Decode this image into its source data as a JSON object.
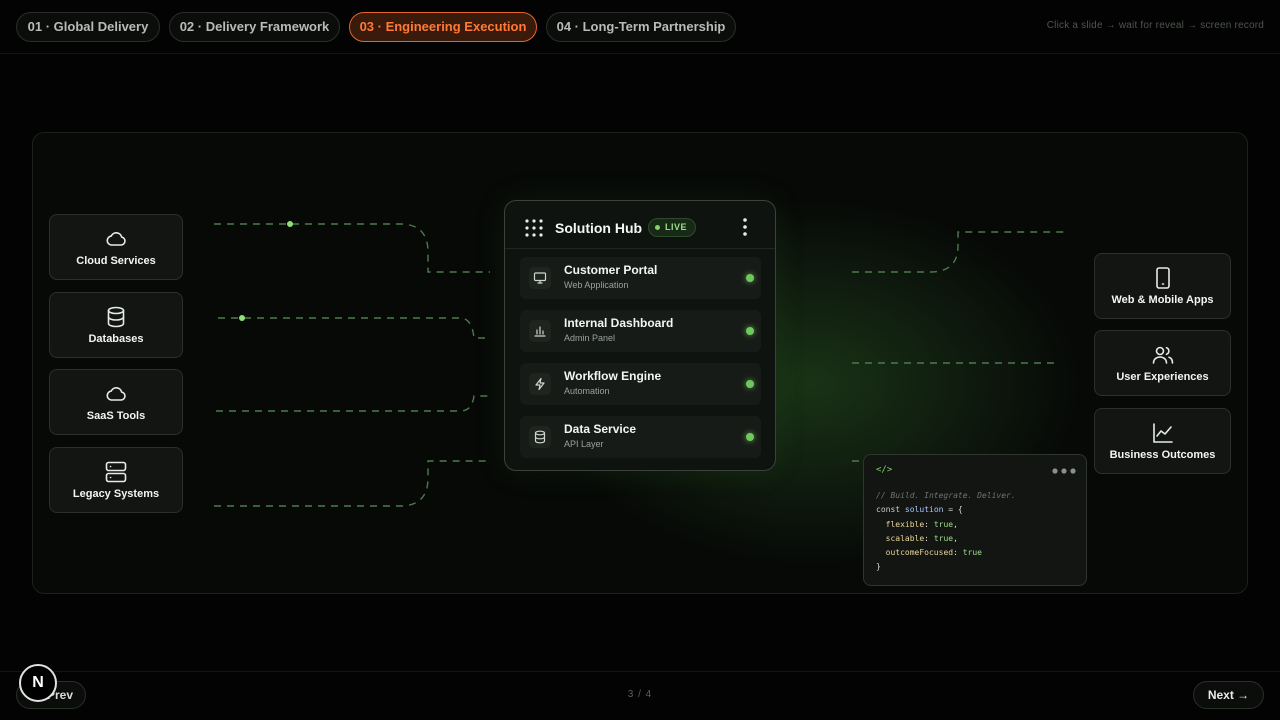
{
  "tabs": [
    {
      "label": "01 · Global Delivery",
      "active": false
    },
    {
      "label": "02 · Delivery Framework",
      "active": false
    },
    {
      "label": "03 · Engineering Execution",
      "active": true
    },
    {
      "label": "04 · Long-Term Partnership",
      "active": false
    }
  ],
  "hint": "Click a slide → wait for reveal → screen record",
  "sources": [
    {
      "label": "Cloud Services",
      "icon": "cloud-icon"
    },
    {
      "label": "Databases",
      "icon": "database-icon"
    },
    {
      "label": "SaaS Tools",
      "icon": "cloud-icon"
    },
    {
      "label": "Legacy Systems",
      "icon": "server-icon"
    }
  ],
  "hub": {
    "title": "Solution Hub",
    "status": "LIVE",
    "services": [
      {
        "name": "Customer Portal",
        "sub": "Web Application",
        "icon": "monitor-icon"
      },
      {
        "name": "Internal Dashboard",
        "sub": "Admin Panel",
        "icon": "bar-chart-icon"
      },
      {
        "name": "Workflow Engine",
        "sub": "Automation",
        "icon": "lightning-icon"
      },
      {
        "name": "Data Service",
        "sub": "API Layer",
        "icon": "database-icon"
      }
    ]
  },
  "outputs": [
    {
      "label": "Web & Mobile Apps",
      "icon": "smartphone-icon"
    },
    {
      "label": "User Experiences",
      "icon": "users-icon"
    },
    {
      "label": "Business Outcomes",
      "icon": "line-chart-icon"
    }
  ],
  "code": {
    "tag": "</>",
    "comment": "// Build. Integrate. Deliver.",
    "line1_kw": "const",
    "line1_var": "solution",
    "line1_rest": " = {",
    "k1": "flexible",
    "v1": "true",
    "k2": "scalable",
    "v2": "true",
    "k3": "outcomeFocused",
    "v3": "true",
    "close": "}"
  },
  "footer": {
    "prev_label": "Prev",
    "next_label": "Next →",
    "counter": "3 / 4",
    "logo_letter": "N"
  },
  "colors": {
    "accent": "#ff7a35",
    "live_green": "#7fd36a",
    "line_green": "#4d7a4d"
  }
}
